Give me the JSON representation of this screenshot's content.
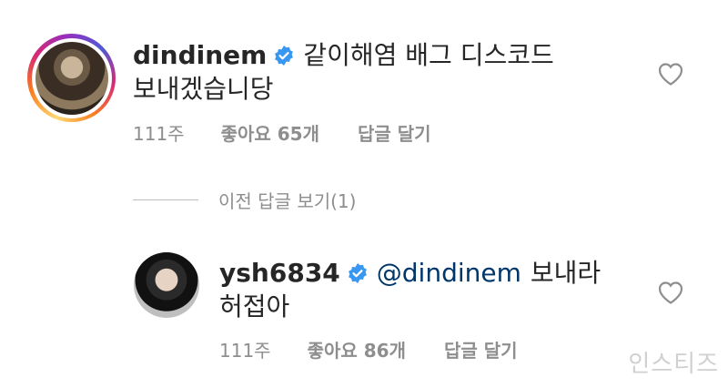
{
  "comments": [
    {
      "username": "dindinem",
      "text_line1": "같이해염 배그 디스코드",
      "text_line2": "보내겠습니당",
      "time": "111주",
      "likes": "좋아요 65개",
      "reply": "답글 달기"
    },
    {
      "username": "ysh6834",
      "mention": "@dindinem",
      "text_line1": "보내라",
      "text_line2": "허접아",
      "time": "111주",
      "likes": "좋아요 86개",
      "reply": "답글 달기"
    }
  ],
  "view_replies": "이전 답글 보기(1)",
  "watermark": "인스티즈",
  "colors": {
    "verified": "#3897f0",
    "mention": "#00376b",
    "meta": "#8e8e8e"
  }
}
